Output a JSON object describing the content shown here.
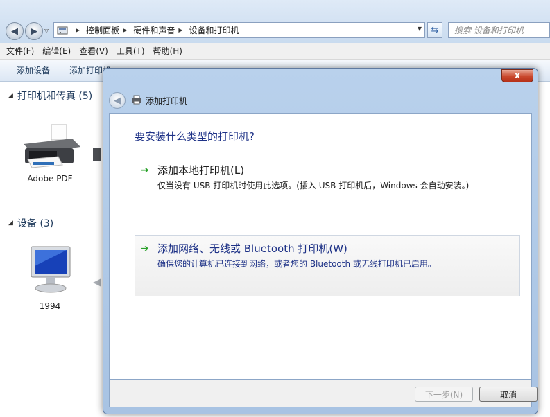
{
  "explorer": {
    "breadcrumbs": [
      "控制面板",
      "硬件和声音",
      "设备和打印机"
    ],
    "search_placeholder": "搜索 设备和打印机",
    "menu": [
      "文件(F)",
      "编辑(E)",
      "查看(V)",
      "工具(T)",
      "帮助(H)"
    ],
    "commands": [
      "添加设备",
      "添加打印机"
    ],
    "sections": [
      {
        "title": "打印机和传真 (5)",
        "devices": [
          "Adobe PDF"
        ]
      },
      {
        "title": "设备 (3)",
        "devices": [
          "1994"
        ]
      }
    ]
  },
  "dialog": {
    "title": "添加打印机",
    "close_label": "x",
    "question": "要安装什么类型的打印机?",
    "options": [
      {
        "title": "添加本地打印机(L)",
        "desc": "仅当没有 USB 打印机时使用此选项。(插入 USB 打印机后，Windows 会自动安装。)"
      },
      {
        "title": "添加网络、无线或 Bluetooth 打印机(W)",
        "desc": "确保您的计算机已连接到网络，或者您的 Bluetooth 或无线打印机已启用。"
      }
    ],
    "next_label": "下一步(N)",
    "cancel_label": "取消"
  },
  "colors": {
    "accent_text": "#1e3287",
    "arrow_green": "#2aa12a",
    "close_red": "#c9482d"
  }
}
